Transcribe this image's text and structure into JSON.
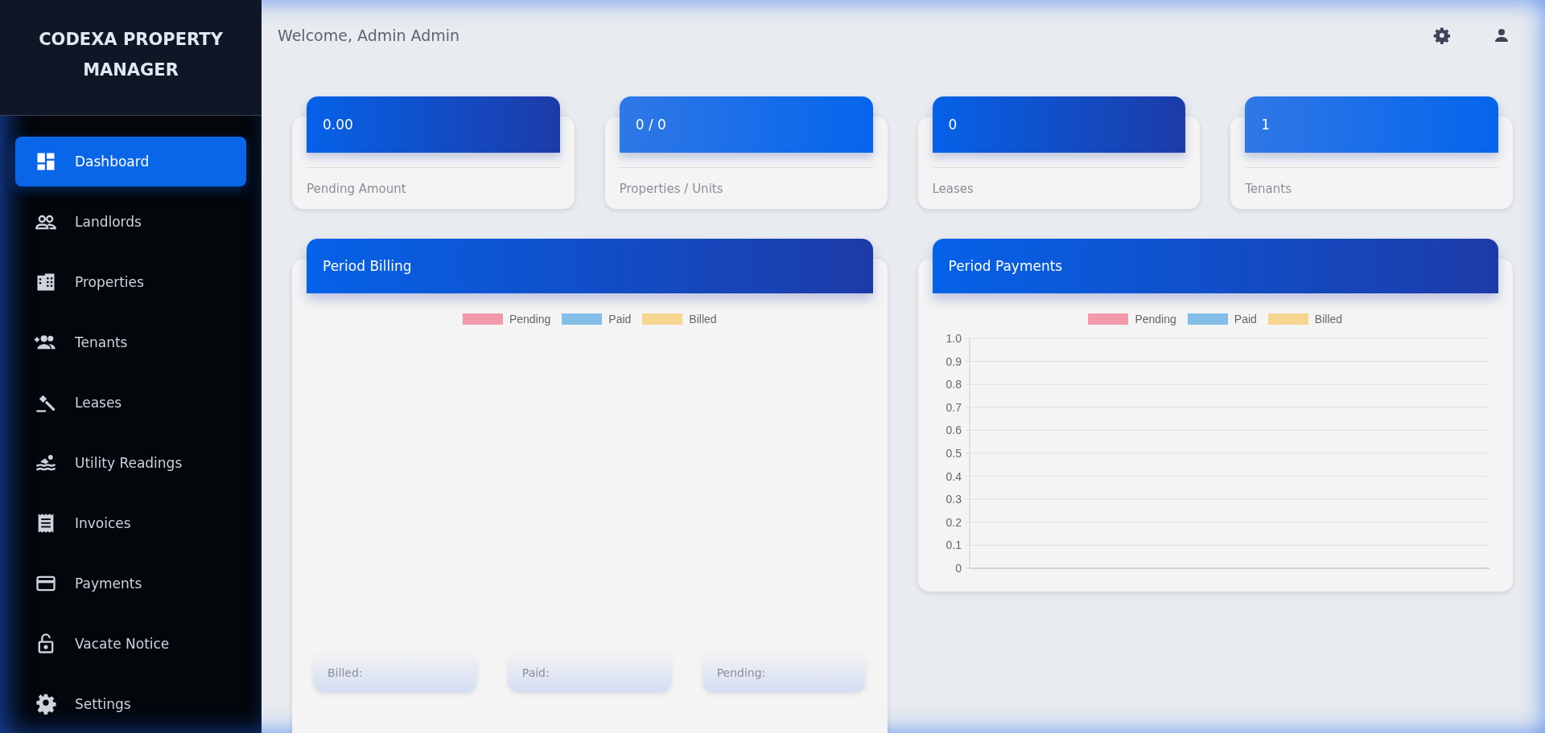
{
  "sidebar": {
    "brand": "CODEXA PROPERTY MANAGER",
    "items": [
      {
        "label": "Dashboard",
        "selected": true
      },
      {
        "label": "Landlords",
        "selected": false
      },
      {
        "label": "Properties",
        "selected": false
      },
      {
        "label": "Tenants",
        "selected": false
      },
      {
        "label": "Leases",
        "selected": false
      },
      {
        "label": "Utility Readings",
        "selected": false
      },
      {
        "label": "Invoices",
        "selected": false
      },
      {
        "label": "Payments",
        "selected": false
      },
      {
        "label": "Vacate Notice",
        "selected": false
      },
      {
        "label": "Settings",
        "selected": false
      }
    ]
  },
  "header": {
    "welcome": "Welcome, Admin Admin"
  },
  "stats": [
    {
      "value": "0.00",
      "label": "Pending Amount"
    },
    {
      "value": "0 / 0",
      "label": "Properties / Units"
    },
    {
      "value": "0",
      "label": "Leases"
    },
    {
      "value": "1",
      "label": "Tenants"
    }
  ],
  "billing": {
    "title": "Period Billing",
    "legend": [
      {
        "label": "Pending",
        "color": "#f29aac"
      },
      {
        "label": "Paid",
        "color": "#84bde8"
      },
      {
        "label": "Billed",
        "color": "#f5d58f"
      }
    ],
    "totals": [
      {
        "label": "Billed:"
      },
      {
        "label": "Paid:"
      },
      {
        "label": "Pending:"
      }
    ]
  },
  "payments": {
    "title": "Period Payments",
    "chart_data": {
      "type": "bar",
      "series": [
        {
          "name": "Pending",
          "color": "#f29aac"
        },
        {
          "name": "Paid",
          "color": "#84bde8"
        },
        {
          "name": "Billed",
          "color": "#f5d58f"
        }
      ],
      "grid": true,
      "ylim": [
        0,
        1
      ],
      "yticks": [
        {
          "value": 0,
          "label": "0"
        },
        {
          "value": 0.1,
          "label": "0.1"
        },
        {
          "value": 0.2,
          "label": "0.2"
        },
        {
          "value": 0.3,
          "label": "0.3"
        },
        {
          "value": 0.4,
          "label": "0.4"
        },
        {
          "value": 0.5,
          "label": "0.5"
        },
        {
          "value": 0.6,
          "label": "0.6"
        },
        {
          "value": 0.7,
          "label": "0.7"
        },
        {
          "value": 0.8,
          "label": "0.8"
        },
        {
          "value": 0.9,
          "label": "0.9"
        },
        {
          "value": 1,
          "label": "1.0"
        }
      ]
    }
  }
}
